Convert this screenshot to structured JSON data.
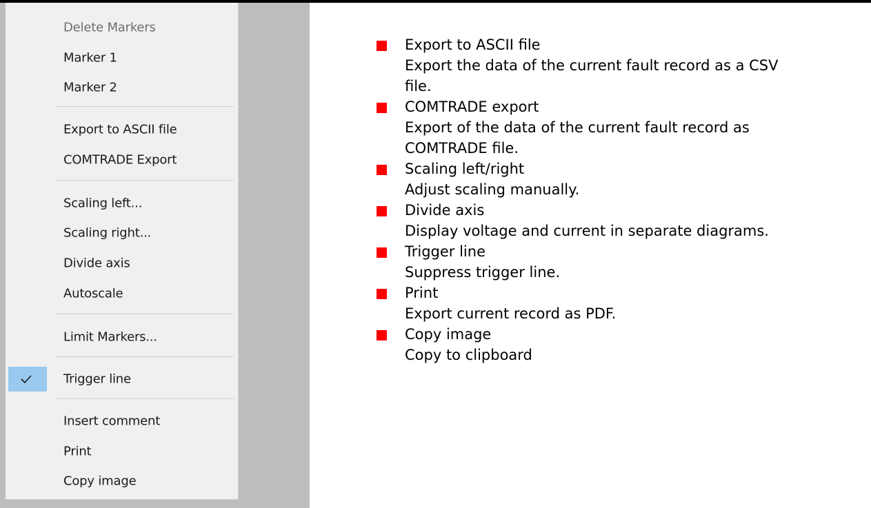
{
  "context_menu": {
    "items": [
      {
        "label": "Delete Markers",
        "disabled": true
      },
      {
        "label": "Marker 1"
      },
      {
        "label": "Marker 2"
      },
      {
        "label": "Export to ASCII file"
      },
      {
        "label": "COMTRADE  Export"
      },
      {
        "label": "Scaling left..."
      },
      {
        "label": "Scaling right..."
      },
      {
        "label": "Divide axis"
      },
      {
        "label": "Autoscale"
      },
      {
        "label": "Limit Markers..."
      },
      {
        "label": "Trigger line",
        "checked": true
      },
      {
        "label": "Insert comment"
      },
      {
        "label": "Print"
      },
      {
        "label": "Copy image"
      }
    ]
  },
  "help": {
    "bullet_color": "#ff0000",
    "items": [
      {
        "title": "Export to ASCII file",
        "desc_lines": [
          "Export the data of the current fault record as a CSV",
          "file."
        ]
      },
      {
        "title": "COMTRADE export",
        "desc_lines": [
          "Export of the data of the current fault record as",
          "COMTRADE file."
        ]
      },
      {
        "title": "Scaling left/right",
        "desc_lines": [
          "Adjust scaling manually."
        ]
      },
      {
        "title": "Divide axis",
        "desc_lines": [
          "Display voltage and current in separate diagrams."
        ]
      },
      {
        "title": "Trigger line",
        "desc_lines": [
          "Suppress trigger line."
        ]
      },
      {
        "title": "Print",
        "desc_lines": [
          "Export current record as PDF."
        ]
      },
      {
        "title": "Copy image",
        "desc_lines": [
          "Copy to clipboard"
        ]
      }
    ]
  }
}
